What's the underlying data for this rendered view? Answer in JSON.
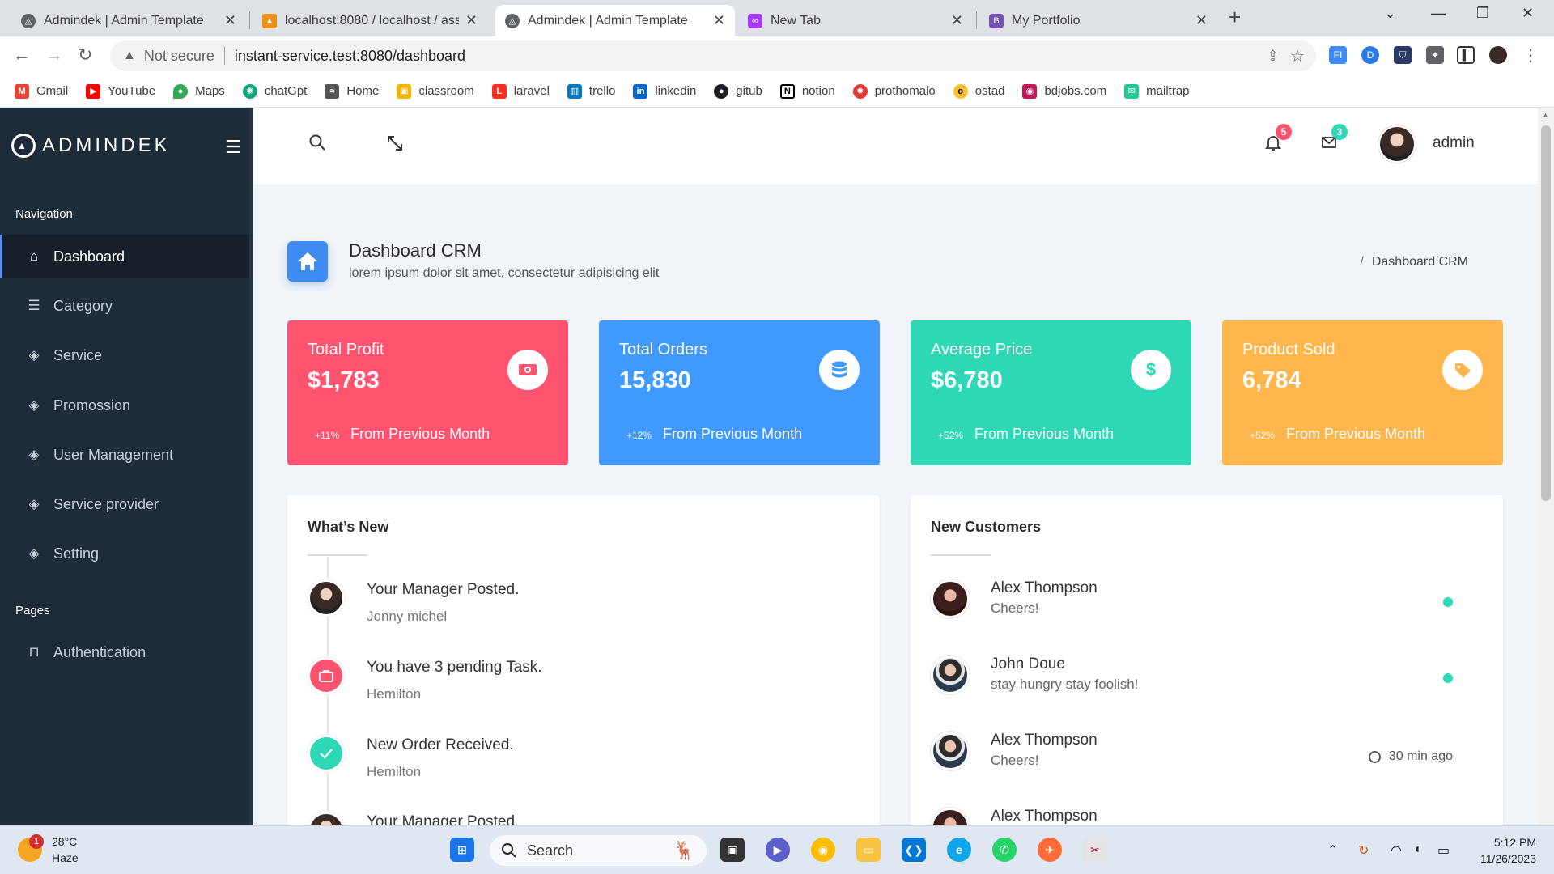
{
  "browser": {
    "tabs": [
      {
        "title": "Admindek | Admin Template",
        "active": false
      },
      {
        "title": "localhost:8080 / localhost / assig",
        "active": false
      },
      {
        "title": "Admindek | Admin Template",
        "active": true
      },
      {
        "title": "New Tab",
        "active": false
      },
      {
        "title": "My Portfolio",
        "active": false
      }
    ],
    "security_label": "Not secure",
    "url": "instant-service.test:8080/dashboard",
    "bookmarks": [
      "Gmail",
      "YouTube",
      "Maps",
      "chatGpt",
      "Home",
      "classroom",
      "laravel",
      "trello",
      "linkedin",
      "gitub",
      "notion",
      "prothomalo",
      "ostad",
      "bdjobs.com",
      "mailtrap"
    ]
  },
  "sidebar": {
    "logo": "ADMINDEK",
    "nav_heading": "Navigation",
    "items": [
      {
        "label": "Dashboard",
        "icon": "home-icon",
        "active": true
      },
      {
        "label": "Category",
        "icon": "database-icon"
      },
      {
        "label": "Service",
        "icon": "layers-icon"
      },
      {
        "label": "Promossion",
        "icon": "layers-icon"
      },
      {
        "label": "User Management",
        "icon": "layers-icon"
      },
      {
        "label": "Service provider",
        "icon": "layers-icon"
      },
      {
        "label": "Setting",
        "icon": "layers-icon"
      }
    ],
    "pages_heading": "Pages",
    "pages": [
      {
        "label": "Authentication",
        "icon": "lock-icon"
      }
    ]
  },
  "topbar": {
    "notifications_count": "5",
    "messages_count": "3",
    "user_name": "admin"
  },
  "page": {
    "title": "Dashboard CRM",
    "subtitle": "lorem ipsum dolor sit amet, consectetur adipisicing elit",
    "breadcrumb": "Dashboard CRM"
  },
  "stats": [
    {
      "label": "Total Profit",
      "value": "$1,783",
      "change": "+11%",
      "note": "From Previous Month",
      "color": "#ff5370",
      "icon": "money-icon"
    },
    {
      "label": "Total Orders",
      "value": "15,830",
      "change": "+12%",
      "note": "From Previous Month",
      "color": "#4099ff",
      "icon": "database-icon"
    },
    {
      "label": "Average Price",
      "value": "$6,780",
      "change": "+52%",
      "note": "From Previous Month",
      "color": "#2ed8b6",
      "icon": "dollar-icon"
    },
    {
      "label": "Product Sold",
      "value": "6,784",
      "change": "+52%",
      "note": "From Previous Month",
      "color": "#ffb64d",
      "icon": "tag-icon"
    }
  ],
  "whats_new": {
    "title": "What’s New",
    "items": [
      {
        "title": "Your Manager Posted.",
        "sub": "Jonny michel",
        "icon": "avatar-icon"
      },
      {
        "title": "You have 3 pending Task.",
        "sub": "Hemilton",
        "icon": "briefcase-icon",
        "color": "#ff5370"
      },
      {
        "title": "New Order Received.",
        "sub": "Hemilton",
        "icon": "check-icon",
        "color": "#2ed8b6"
      },
      {
        "title": "Your Manager Posted.",
        "sub": "",
        "icon": "avatar-icon"
      }
    ]
  },
  "new_customers": {
    "title": "New Customers",
    "items": [
      {
        "name": "Alex Thompson",
        "message": "Cheers!",
        "status": "online"
      },
      {
        "name": "John Doue",
        "message": "stay hungry stay foolish!",
        "status": "online"
      },
      {
        "name": "Alex Thompson",
        "message": "Cheers!",
        "status": "30 min ago"
      },
      {
        "name": "Alex Thompson",
        "message": "",
        "status": ""
      }
    ]
  },
  "taskbar": {
    "temperature": "28°C",
    "weather": "Haze",
    "weather_badge": "1",
    "search_label": "Search",
    "time": "5:12 PM",
    "date": "11/26/2023"
  }
}
